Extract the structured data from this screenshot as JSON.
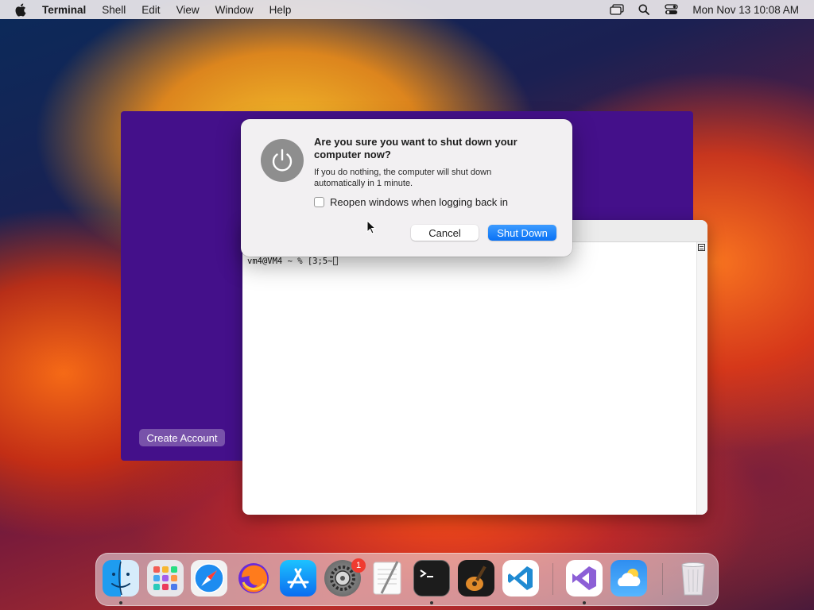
{
  "menubar": {
    "app_name": "Terminal",
    "menus": [
      "Shell",
      "Edit",
      "View",
      "Window",
      "Help"
    ],
    "clock": "Mon Nov 13  10:08 AM"
  },
  "account_panel": {
    "create_account_label": "Create Account"
  },
  "terminal": {
    "prompt_text": "vm4@VM4 ~ % [3;5~"
  },
  "dialog": {
    "title": "Are you sure you want to shut down your computer now?",
    "message": "If you do nothing, the computer will shut down automatically in 1 minute.",
    "checkbox_label": "Reopen windows when logging back in",
    "checkbox_checked": false,
    "cancel_label": "Cancel",
    "confirm_label": "Shut Down",
    "accent_color": "#0a72f5"
  },
  "dock": {
    "apps": [
      {
        "name": "Finder",
        "icon": "finder-icon",
        "running": true
      },
      {
        "name": "Launchpad",
        "icon": "launchpad-icon",
        "running": false
      },
      {
        "name": "Safari",
        "icon": "safari-icon",
        "running": false
      },
      {
        "name": "Firefox",
        "icon": "firefox-icon",
        "running": false
      },
      {
        "name": "App Store",
        "icon": "app-store-icon",
        "running": false
      },
      {
        "name": "System Settings",
        "icon": "system-settings-icon",
        "running": false
      },
      {
        "name": "TextEdit",
        "icon": "textedit-icon",
        "running": false
      },
      {
        "name": "Terminal",
        "icon": "terminal-icon",
        "running": true
      },
      {
        "name": "GarageBand",
        "icon": "garageband-icon",
        "running": false
      },
      {
        "name": "Visual Studio Code",
        "icon": "vscode-icon",
        "running": false
      },
      {
        "name": "Visual Studio",
        "icon": "visual-studio-icon",
        "running": true
      },
      {
        "name": "Weather",
        "icon": "weather-icon",
        "running": false
      },
      {
        "name": "Trash",
        "icon": "trash-icon",
        "running": false
      }
    ],
    "system_settings_badge": "1"
  }
}
